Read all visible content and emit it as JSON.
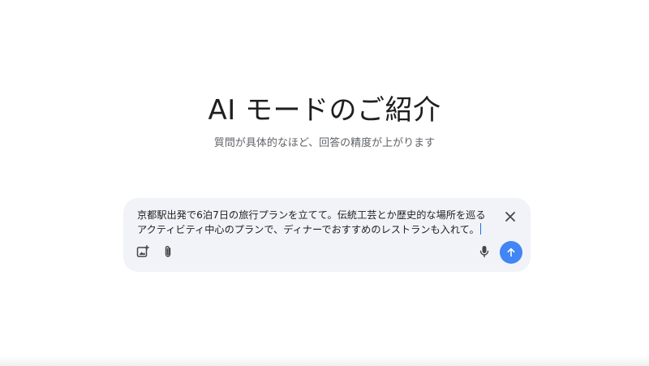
{
  "header": {
    "title": "AI モードのご紹介",
    "subtitle": "質問が具体的なほど、回答の精度が上がります"
  },
  "composer": {
    "query_value": "京都駅出発で6泊7日の旅行プランを立てて。伝統工芸とか歴史的な場所を巡るアクティビティ中心のプランで、ディナーでおすすめのレストランも入れて。",
    "icons": {
      "clear": "close-icon",
      "image": "add-image-icon",
      "attach": "paperclip-icon",
      "mic": "microphone-icon",
      "send": "arrow-up-icon"
    },
    "send_color": "#4285f4"
  }
}
